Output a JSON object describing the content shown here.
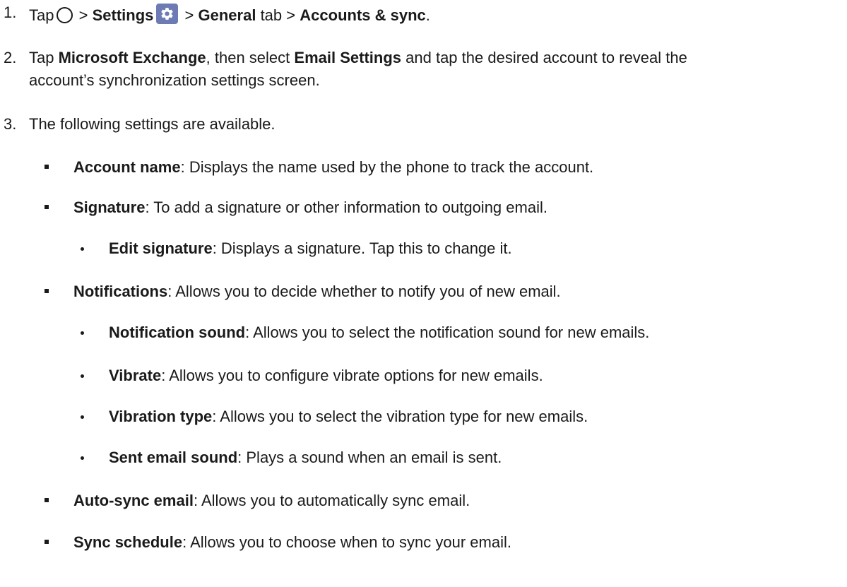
{
  "steps": [
    {
      "number": "1.",
      "parts": {
        "tap": "Tap",
        "sep1": ">",
        "settings": "Settings",
        "sep2": ">",
        "general": "General",
        "tab": "tab",
        "sep3": ">",
        "accounts": "Accounts & sync",
        "period": "."
      }
    },
    {
      "number": "2.",
      "parts": {
        "tap": "Tap",
        "exchange": "Microsoft Exchange",
        "then": ", then select",
        "email_settings": "Email Settings",
        "rest1": "and tap the desired account to reveal the",
        "rest2": "account’s synchronization settings screen."
      }
    },
    {
      "number": "3.",
      "text": "The following settings are available."
    }
  ],
  "settings": [
    {
      "label": "Account name",
      "desc": ": Displays the name used by the phone to track the account."
    },
    {
      "label": "Signature",
      "desc": ": To add a signature or other information to outgoing email."
    },
    {
      "label": "Edit signature",
      "desc": ": Displays a signature. Tap this to change it."
    },
    {
      "label": "Notifications",
      "desc": ": Allows you to decide whether to notify you of new email."
    },
    {
      "label": "Notification sound",
      "desc": ": Allows you to select the notification sound for new emails."
    },
    {
      "label": "Vibrate",
      "desc": ": Allows you to configure vibrate options for new emails."
    },
    {
      "label": "Vibration type",
      "desc": ": Allows you to select the vibration type for new emails."
    },
    {
      "label": "Sent email sound",
      "desc": ": Plays a sound when an email is sent."
    },
    {
      "label": "Auto-sync email",
      "desc": ": Allows you to automatically sync email."
    },
    {
      "label": "Sync schedule",
      "desc": ": Allows you to choose when to sync your email."
    }
  ],
  "icons": {
    "home": "home-circle-icon",
    "settings": "settings-gear-icon",
    "settings_color": "#6c7bb4"
  }
}
